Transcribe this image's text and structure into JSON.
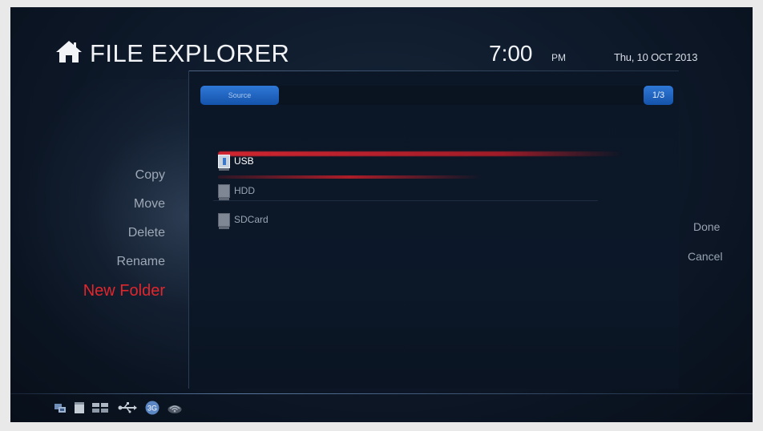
{
  "header": {
    "home_icon": "home-icon",
    "title": "FILE EXPLORER",
    "time": "7:00",
    "ampm": "PM",
    "date": "Thu, 10 OCT 2013"
  },
  "toolbar": {
    "source_label": "Source",
    "page_indicator": "1/3"
  },
  "devices": [
    {
      "label": "USB",
      "icon": "usb-drive-icon",
      "selected": true
    },
    {
      "label": "HDD",
      "icon": "hdd-icon",
      "selected": false
    },
    {
      "label": "SDCard",
      "icon": "sdcard-icon",
      "selected": false
    }
  ],
  "left_menu": {
    "copy": "Copy",
    "move": "Move",
    "delete": "Delete",
    "rename": "Rename",
    "new_folder": "New Folder"
  },
  "right_menu": {
    "done": "Done",
    "cancel": "Cancel"
  },
  "status_bar": {
    "icons": [
      "network-icon",
      "storage-icon",
      "sdcard-icon",
      "usb-icon",
      "3g-icon",
      "wifi-icon"
    ],
    "badge_3g": "3G"
  },
  "colors": {
    "accent_blue": "#1f64c4",
    "highlight_red": "#e1262c",
    "background": "#0d1828"
  }
}
